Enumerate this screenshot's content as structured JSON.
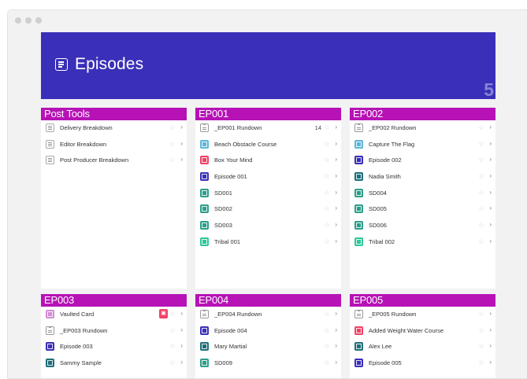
{
  "header": {
    "title": "Episodes",
    "count": "5"
  },
  "colors": {
    "hero": "#3a2fb8",
    "column_header": "#b612b6"
  },
  "columns": [
    {
      "title": "Post Tools",
      "items": [
        {
          "label": "Delivery Breakdown",
          "icon": "document-icon",
          "color": ""
        },
        {
          "label": "Editor Breakdown",
          "icon": "document-icon",
          "color": ""
        },
        {
          "label": "Post Producer Breakdown",
          "icon": "document-icon",
          "color": ""
        }
      ]
    },
    {
      "title": "EP001",
      "items": [
        {
          "label": "_EP001 Rundown",
          "icon": "clipboard-icon",
          "color": "",
          "count": "14"
        },
        {
          "label": "Beach Obstacle Course",
          "icon": "page-icon",
          "color": "#5fb6d8"
        },
        {
          "label": "Box Your Mind",
          "icon": "page-icon",
          "color": "#ef4265"
        },
        {
          "label": "Episode 001",
          "icon": "page-icon",
          "color": "#3a2fb8"
        },
        {
          "label": "SD001",
          "icon": "page-icon",
          "color": "#2e9e8a"
        },
        {
          "label": "SD002",
          "icon": "page-icon",
          "color": "#2e9e8a"
        },
        {
          "label": "SD003",
          "icon": "page-icon",
          "color": "#2e9e8a"
        },
        {
          "label": "Tribal 001",
          "icon": "page-icon",
          "color": "#2fc79a"
        }
      ]
    },
    {
      "title": "EP002",
      "items": [
        {
          "label": "_EP002 Rundown",
          "icon": "clipboard-icon",
          "color": ""
        },
        {
          "label": "Capture The Flag",
          "icon": "page-icon",
          "color": "#5fb6d8"
        },
        {
          "label": "Episode 002",
          "icon": "page-icon",
          "color": "#3a2fb8"
        },
        {
          "label": "Nadia Smith",
          "icon": "page-icon",
          "color": "#1f6f7a"
        },
        {
          "label": "SD004",
          "icon": "page-icon",
          "color": "#2e9e8a"
        },
        {
          "label": "SD005",
          "icon": "page-icon",
          "color": "#2e9e8a"
        },
        {
          "label": "SD006",
          "icon": "page-icon",
          "color": "#2e9e8a"
        },
        {
          "label": "Tribal 002",
          "icon": "page-icon",
          "color": "#2fc79a"
        }
      ]
    },
    {
      "title": "EP003",
      "items": [
        {
          "label": "Vaulted Card",
          "icon": "page-icon",
          "color": "#d58ad8",
          "badge": true
        },
        {
          "label": "_EP003 Rundown",
          "icon": "clipboard-icon",
          "color": ""
        },
        {
          "label": "Episode 003",
          "icon": "page-icon",
          "color": "#3a2fb8"
        },
        {
          "label": "Sammy Sample",
          "icon": "page-icon",
          "color": "#1f6f7a"
        }
      ]
    },
    {
      "title": "EP004",
      "items": [
        {
          "label": "_EP004 Rundown",
          "icon": "clipboard-icon",
          "color": ""
        },
        {
          "label": "Episode 004",
          "icon": "page-icon",
          "color": "#3a2fb8"
        },
        {
          "label": "Mary Martial",
          "icon": "page-icon",
          "color": "#1f6f7a"
        },
        {
          "label": "SD009",
          "icon": "page-icon",
          "color": "#2e9e8a"
        }
      ]
    },
    {
      "title": "EP005",
      "items": [
        {
          "label": "_EP005 Rundown",
          "icon": "clipboard-icon",
          "color": ""
        },
        {
          "label": "Added Weight Water Course",
          "icon": "page-icon",
          "color": "#ef4265"
        },
        {
          "label": "Alex Lee",
          "icon": "page-icon",
          "color": "#1f6f7a"
        },
        {
          "label": "Episode 005",
          "icon": "page-icon",
          "color": "#3a2fb8"
        }
      ]
    }
  ]
}
